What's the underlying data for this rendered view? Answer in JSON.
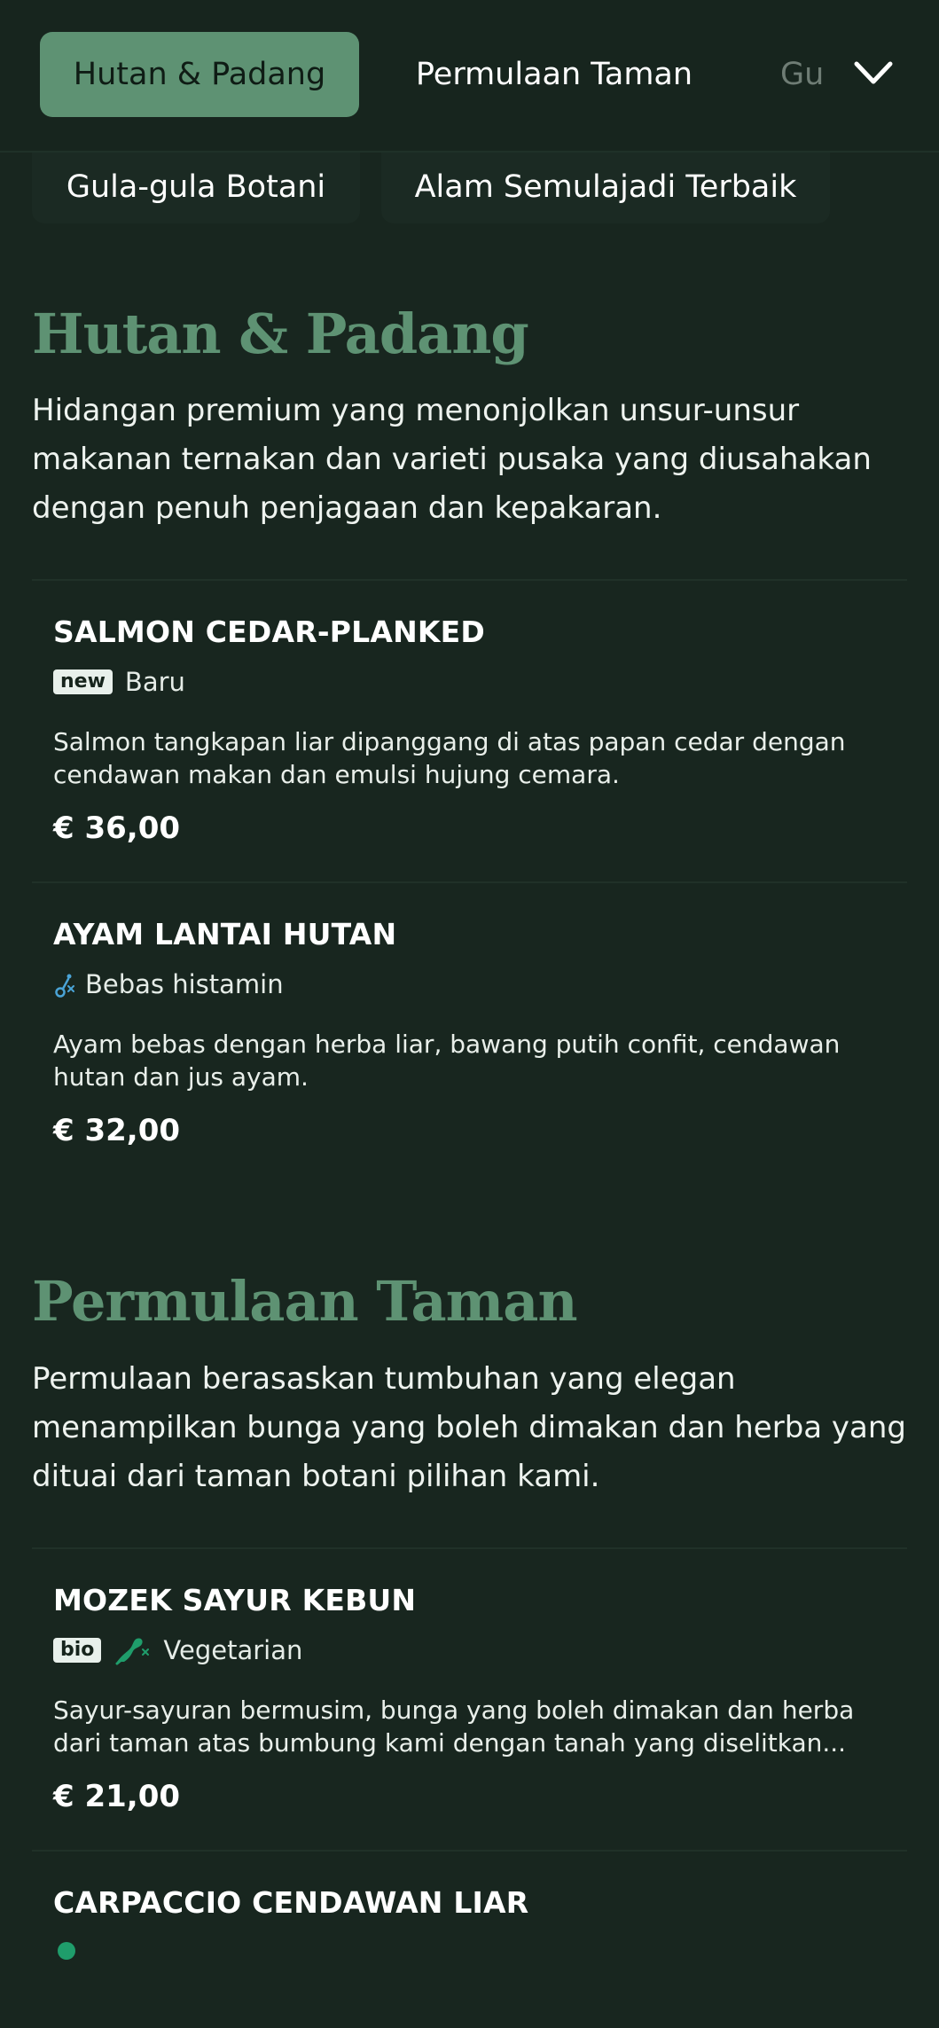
{
  "nav": {
    "tabs": [
      {
        "label": "Hutan & Padang",
        "active": true
      },
      {
        "label": "Permulaan Taman",
        "active": false
      },
      {
        "label": "Gu",
        "active": false
      }
    ],
    "tabs_row2": [
      {
        "label": "Gula-gula Botani"
      },
      {
        "label": "Alam Semulajadi Terbaik"
      }
    ]
  },
  "sections": [
    {
      "title": "Hutan & Padang",
      "description": "Hidangan premium yang menonjolkan unsur-unsur makanan ternakan dan varieti pusaka yang diusahakan dengan penuh penjagaan dan kepakaran.",
      "dishes": [
        {
          "name": "SALMON CEDAR-PLANKED",
          "badge": "new",
          "tag": "Baru",
          "description": "Salmon tangkapan liar dipanggang di atas papan cedar dengan cendawan makan dan emulsi hujung cemara.",
          "price": "€ 36,00"
        },
        {
          "name": "AYAM LANTAI HUTAN",
          "icon": "histamine-free-icon",
          "tag": "Bebas histamin",
          "description": "Ayam bebas dengan herba liar, bawang putih confit, cendawan hutan dan jus ayam.",
          "price": "€ 32,00"
        }
      ]
    },
    {
      "title": "Permulaan Taman",
      "description": "Permulaan berasaskan tumbuhan yang elegan menampilkan bunga yang boleh dimakan dan herba yang dituai dari taman botani pilihan kami.",
      "dishes": [
        {
          "name": "MOZEK SAYUR KEBUN",
          "badge": "bio",
          "icon": "vegetarian-icon",
          "tag": "Vegetarian",
          "description": "Sayur-sayuran bermusim, bunga yang boleh dimakan dan herba dari taman atas bumbung kami dengan tanah yang diselitkan...",
          "price": "€ 21,00"
        },
        {
          "name": "CARPACCIO CENDAWAN LIAR"
        }
      ]
    }
  ],
  "colors": {
    "background": "#18261f",
    "accent": "#5e9273",
    "text": "#e8efe9"
  }
}
